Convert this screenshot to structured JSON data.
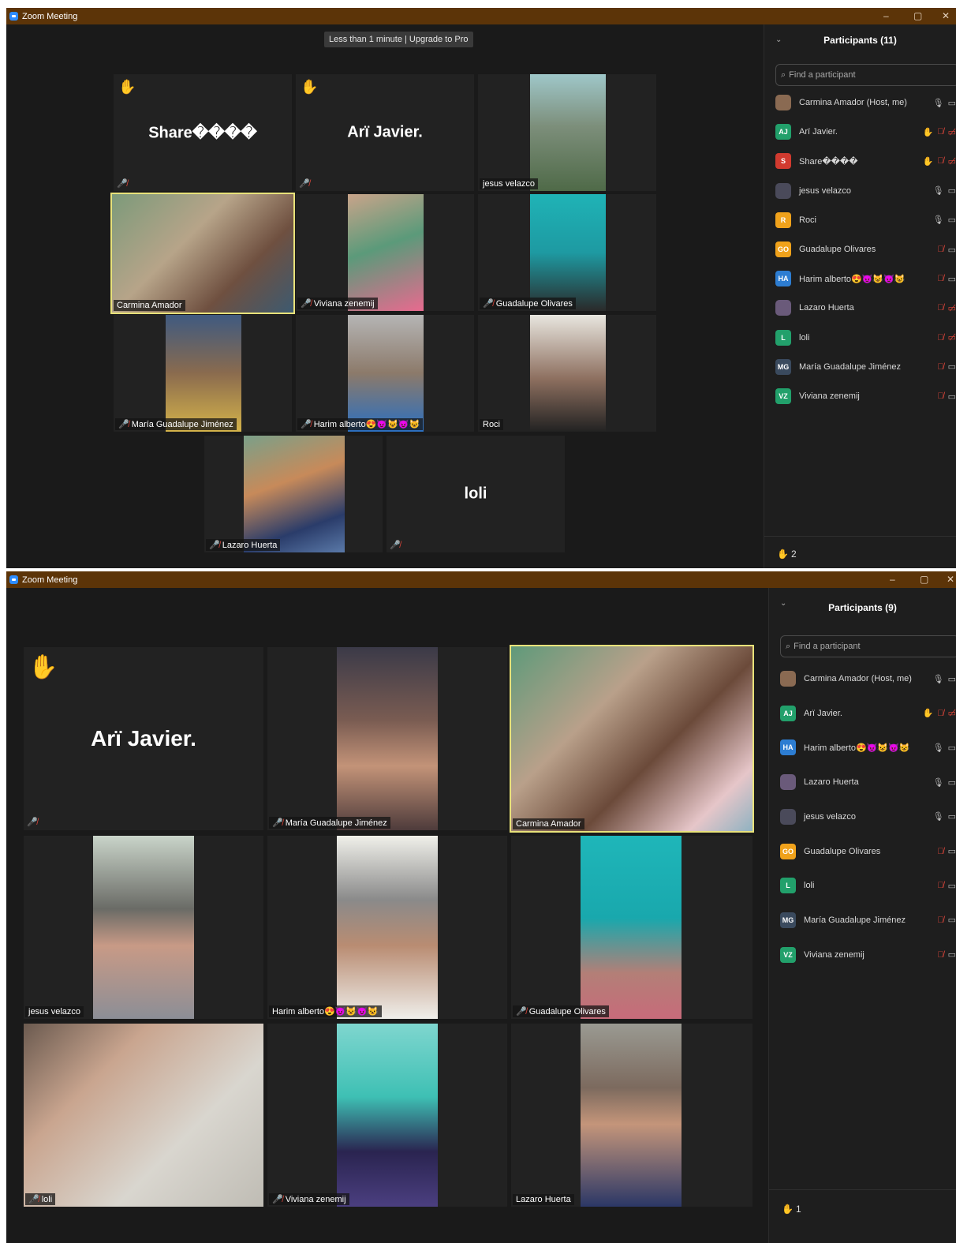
{
  "window_top": {
    "title": "Zoom Meeting",
    "controls": {
      "minimize": "–",
      "restore": "▢",
      "close": "✕"
    },
    "banner": "Less than 1 minute | Upgrade to Pro",
    "tiles": {
      "share": "Share����",
      "ari_big": "Arï Javier.",
      "jesus": "jesus velazco",
      "carmina": "Carmina Amador",
      "viviana": "Viviana zenemij",
      "guadalupe": "Guadalupe Olivares",
      "maria": "María Guadalupe Jiménez",
      "harim": "Harim alberto😍😈😺😈😺",
      "roci": "Roci",
      "lazaro": "Lazaro Huerta",
      "loli_big": "loli"
    },
    "panel": {
      "title": "Participants (11)",
      "search_placeholder": "Find a participant",
      "raised_count": "2",
      "participants": [
        {
          "name": "Carmina Amador (Host, me)",
          "initials": "",
          "color": "#8a6a52"
        },
        {
          "name": "Arï Javier.",
          "initials": "AJ",
          "color": "#22a06b"
        },
        {
          "name": "Share����",
          "initials": "S",
          "color": "#d13a2f"
        },
        {
          "name": "jesus velazco",
          "initials": "",
          "color": "#4a4a5a"
        },
        {
          "name": "Roci",
          "initials": "R",
          "color": "#f0a21b"
        },
        {
          "name": "Guadalupe Olivares",
          "initials": "GO",
          "color": "#f0a21b"
        },
        {
          "name": "Harim alberto😍😈😺😈😺",
          "initials": "HA",
          "color": "#2d7dd2"
        },
        {
          "name": "Lazaro Huerta",
          "initials": "",
          "color": "#6a5a7a"
        },
        {
          "name": "loli",
          "initials": "L",
          "color": "#22a06b"
        },
        {
          "name": "María Guadalupe Jiménez",
          "initials": "MG",
          "color": "#3a4a5e"
        },
        {
          "name": "Viviana zenemij",
          "initials": "VZ",
          "color": "#22a06b"
        }
      ]
    }
  },
  "window_bottom": {
    "title": "Zoom Meeting",
    "controls": {
      "minimize": "–",
      "restore": "▢",
      "close": "✕"
    },
    "tiles": {
      "ari_big": "Arï Javier.",
      "maria": "María Guadalupe Jiménez",
      "carmina": "Carmina Amador",
      "jesus": "jesus velazco",
      "harim": "Harim alberto😍😈😺😈😺",
      "guadalupe": "Guadalupe Olivares",
      "loli": "loli",
      "viviana": "Viviana zenemij",
      "lazaro": "Lazaro Huerta"
    },
    "panel": {
      "title": "Participants (9)",
      "search_placeholder": "Find a participant",
      "raised_count": "1",
      "participants": [
        {
          "name": "Carmina Amador (Host, me)",
          "initials": "",
          "color": "#8a6a52"
        },
        {
          "name": "Arï Javier.",
          "initials": "AJ",
          "color": "#22a06b"
        },
        {
          "name": "Harim alberto😍😈😺😈😺",
          "initials": "HA",
          "color": "#2d7dd2"
        },
        {
          "name": "Lazaro Huerta",
          "initials": "",
          "color": "#6a5a7a"
        },
        {
          "name": "jesus velazco",
          "initials": "",
          "color": "#4a4a5a"
        },
        {
          "name": "Guadalupe Olivares",
          "initials": "GO",
          "color": "#f0a21b"
        },
        {
          "name": "loli",
          "initials": "L",
          "color": "#22a06b"
        },
        {
          "name": "María Guadalupe Jiménez",
          "initials": "MG",
          "color": "#3a4a5e"
        },
        {
          "name": "Viviana zenemij",
          "initials": "VZ",
          "color": "#22a06b"
        }
      ]
    }
  },
  "icons": {
    "hand": "raised-hand-icon",
    "mic_muted": "mic-muted-icon",
    "mic": "mic-icon",
    "camera": "camera-icon",
    "camera_off": "camera-off-icon",
    "search": "search-icon",
    "chevron": "chevron-down-icon"
  },
  "colors": {
    "titlebar": "#5c3408",
    "stage": "#1a1a1a",
    "tile": "#222222",
    "active_border": "#e8e27a",
    "muted": "#e0463a",
    "hand": "#f5b51e"
  }
}
